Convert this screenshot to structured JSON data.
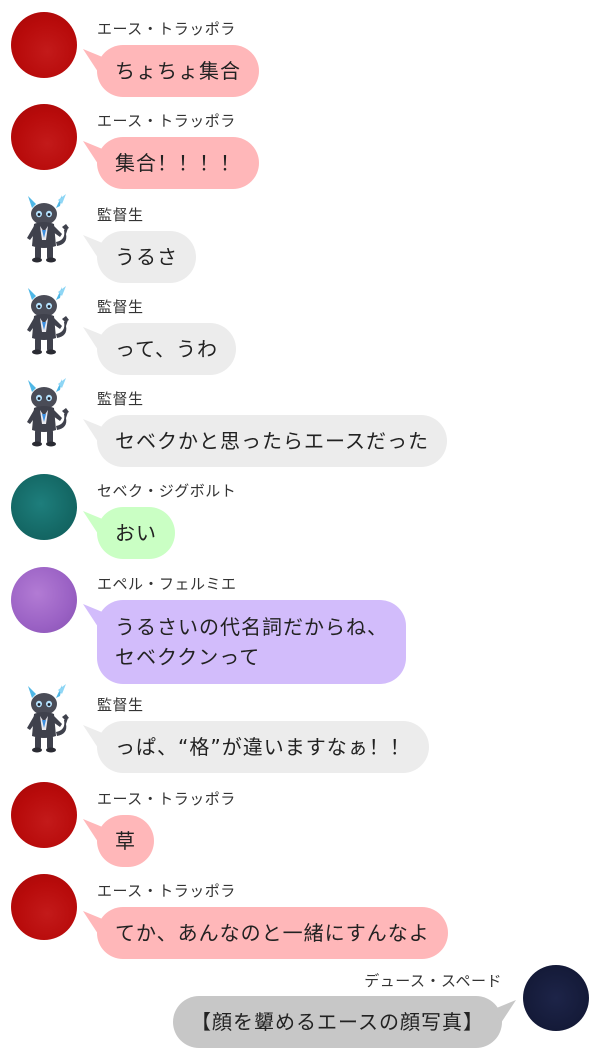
{
  "messages": [
    {
      "sender": "エース・トラッポラ",
      "text": "ちょちょ集合"
    },
    {
      "sender": "エース・トラッポラ",
      "text": "集合！！！！"
    },
    {
      "sender": "監督生",
      "text": "うるさ"
    },
    {
      "sender": "監督生",
      "text": "って、うわ"
    },
    {
      "sender": "監督生",
      "text": "セベクかと思ったらエースだった"
    },
    {
      "sender": "セベク・ジグボルト",
      "text": "おい"
    },
    {
      "sender": "エペル・フェルミエ",
      "line1": "うるさいの代名詞だからね、",
      "line2": "セベククンって"
    },
    {
      "sender": "監督生",
      "text": "っぱ、“格”が違いますなぁ！！"
    },
    {
      "sender": "エース・トラッポラ",
      "text": "草"
    },
    {
      "sender": "エース・トラッポラ",
      "text": "てか、あんなのと一緒にすんなよ"
    },
    {
      "sender": "デュース・スペード",
      "text": "【顔を顰めるエースの顔写真】"
    }
  ],
  "colors": {
    "ace_bubble": "#ffb7b9",
    "kantoku_bubble": "#ececec",
    "sebek_bubble": "#caffc4",
    "epel_bubble": "#d2bcfb",
    "deuce_bubble": "#c7c7c7",
    "ace_avatar": "#b80b0b",
    "sebek_avatar": "#146865",
    "epel_avatar": "#9a61c4",
    "deuce_avatar": "#141a38"
  },
  "icons": {
    "kantoku_avatar": "cat-mascot-icon"
  }
}
